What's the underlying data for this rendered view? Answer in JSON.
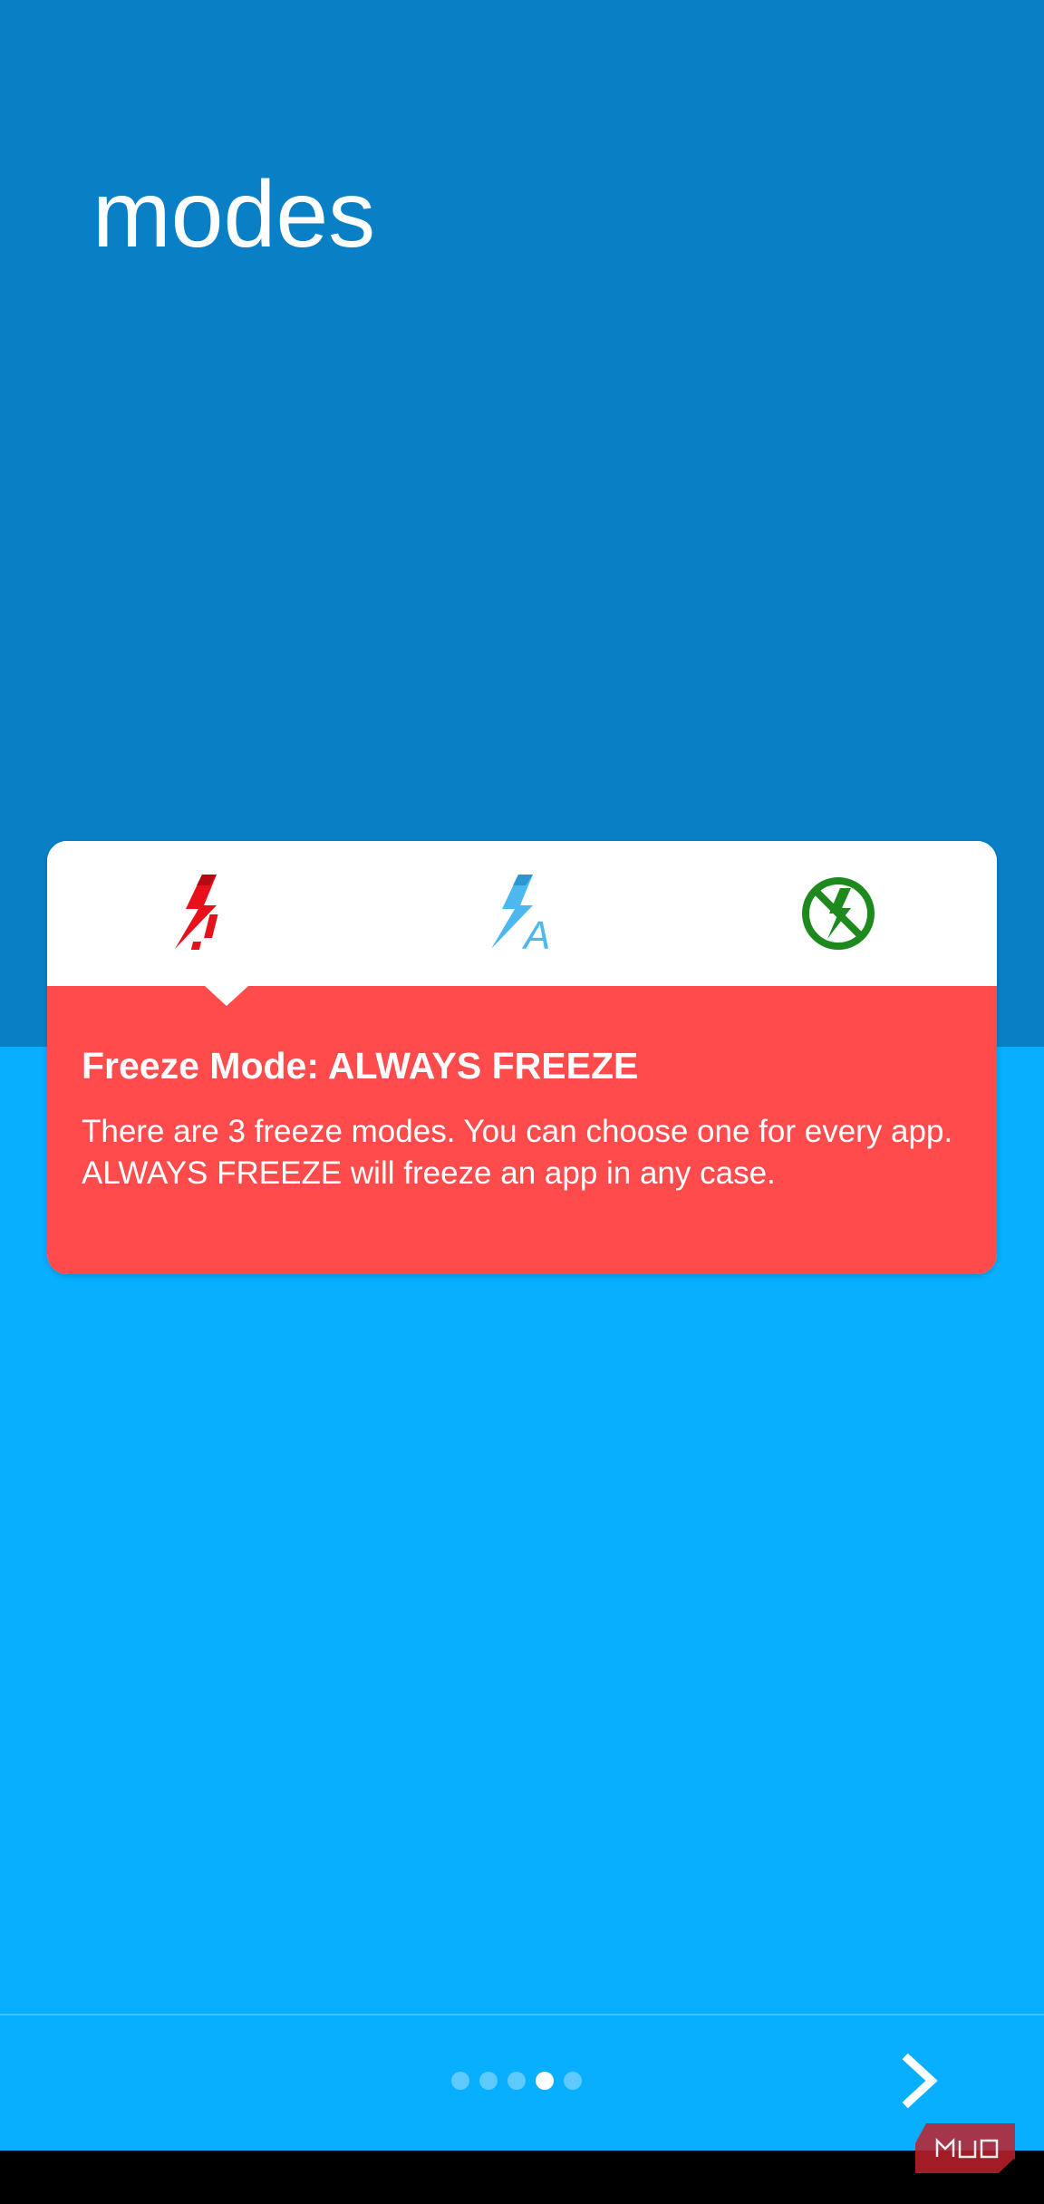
{
  "page": {
    "title": "modes"
  },
  "mode_tabs": [
    {
      "name": "always-freeze",
      "icon": "lightning-exclamation-icon",
      "color": "#E8101B",
      "selected": true
    },
    {
      "name": "auto-freeze",
      "icon": "lightning-a-icon",
      "color": "#4DB8F0",
      "selected": false
    },
    {
      "name": "never-freeze",
      "icon": "circle-crossed-lightning-icon",
      "color": "#1E8A1E",
      "selected": false
    }
  ],
  "card": {
    "heading": "Freeze Mode: ALWAYS FREEZE",
    "description": "There are 3 freeze modes. You can choose one for every app. ALWAYS FREEZE will freeze an app in any case.",
    "body_color": "#FF4B4B"
  },
  "pager": {
    "total": 5,
    "current": 4
  },
  "navigation": {
    "next_icon": "chevron-right-icon"
  },
  "colors": {
    "top_band": "#0980C6",
    "bottom_band": "#08AEFF"
  },
  "watermark": {
    "text": "MUO"
  }
}
